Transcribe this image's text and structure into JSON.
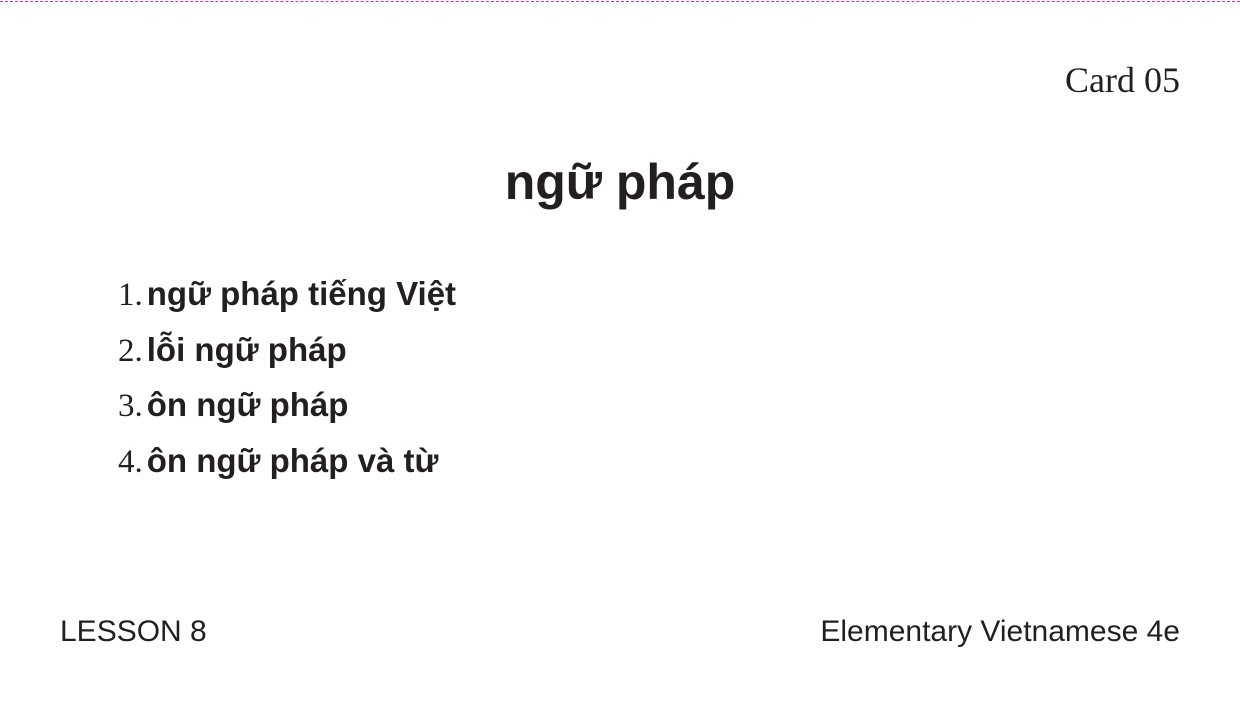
{
  "card": {
    "number_label": "Card 05",
    "headword": "ngữ pháp",
    "phrases": [
      {
        "num": "1.",
        "text": "ngữ pháp tiếng Việt"
      },
      {
        "num": "2.",
        "text": "lỗi ngữ pháp"
      },
      {
        "num": "3.",
        "text": "ôn ngữ pháp"
      },
      {
        "num": "4.",
        "text": "ôn ngữ pháp và từ"
      }
    ]
  },
  "footer": {
    "lesson": "LESSON 8",
    "book": "Elementary Vietnamese 4e"
  },
  "colors": {
    "text": "#231f20",
    "cut_line": "#d6338a",
    "background": "#ffffff"
  }
}
